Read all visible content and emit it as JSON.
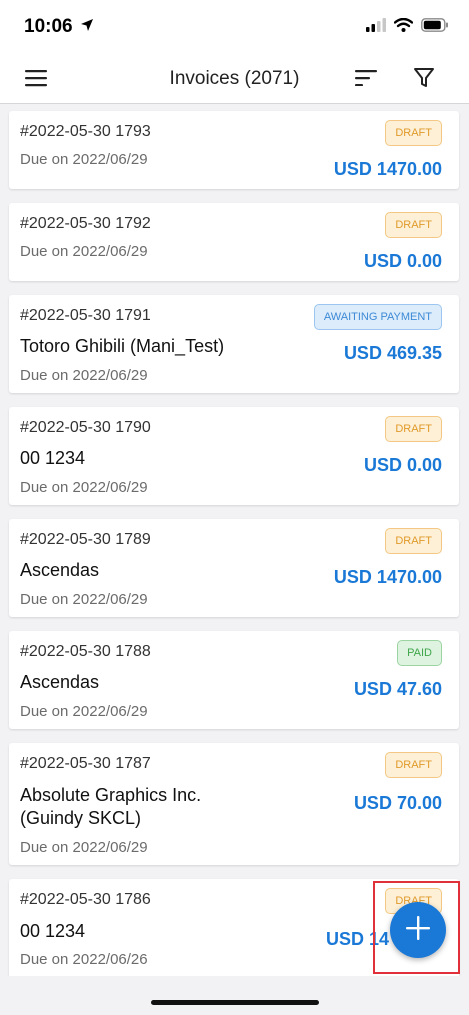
{
  "status": {
    "time": "10:06"
  },
  "header": {
    "title": "Invoices (2071)"
  },
  "invoices": [
    {
      "number": "#2022-05-30 1793",
      "client": "",
      "due": "Due on 2022/06/29",
      "amount": "USD 1470.00",
      "status": "DRAFT"
    },
    {
      "number": "#2022-05-30 1792",
      "client": "",
      "due": "Due on 2022/06/29",
      "amount": "USD 0.00",
      "status": "DRAFT"
    },
    {
      "number": "#2022-05-30 1791",
      "client": "Totoro Ghibili (Mani_Test)",
      "due": "Due on 2022/06/29",
      "amount": "USD 469.35",
      "status": "AWAITING PAYMENT"
    },
    {
      "number": "#2022-05-30 1790",
      "client": "00 1234",
      "due": "Due on 2022/06/29",
      "amount": "USD 0.00",
      "status": "DRAFT"
    },
    {
      "number": "#2022-05-30 1789",
      "client": "Ascendas",
      "due": "Due on 2022/06/29",
      "amount": "USD 1470.00",
      "status": "DRAFT"
    },
    {
      "number": "#2022-05-30 1788",
      "client": "Ascendas",
      "due": "Due on 2022/06/29",
      "amount": "USD 47.60",
      "status": "PAID"
    },
    {
      "number": "#2022-05-30 1787",
      "client_line1": "Absolute Graphics Inc.",
      "client_line2": "(Guindy SKCL)",
      "due": "Due on 2022/06/29",
      "amount": "USD 70.00",
      "status": "DRAFT"
    },
    {
      "number": "#2022-05-30 1786",
      "client": "00 1234",
      "due": "Due on 2022/06/26",
      "amount": "USD 14",
      "status": "DRAFT"
    }
  ],
  "colors": {
    "accent": "#1a78d6",
    "draft": "#e09a2a",
    "awaiting": "#3d8ad6",
    "paid": "#3fa64a",
    "highlight": "#e0303a"
  },
  "icons": {
    "menu": "hamburger-icon",
    "sort": "sort-icon",
    "filter": "filter-icon",
    "add": "plus-icon"
  }
}
